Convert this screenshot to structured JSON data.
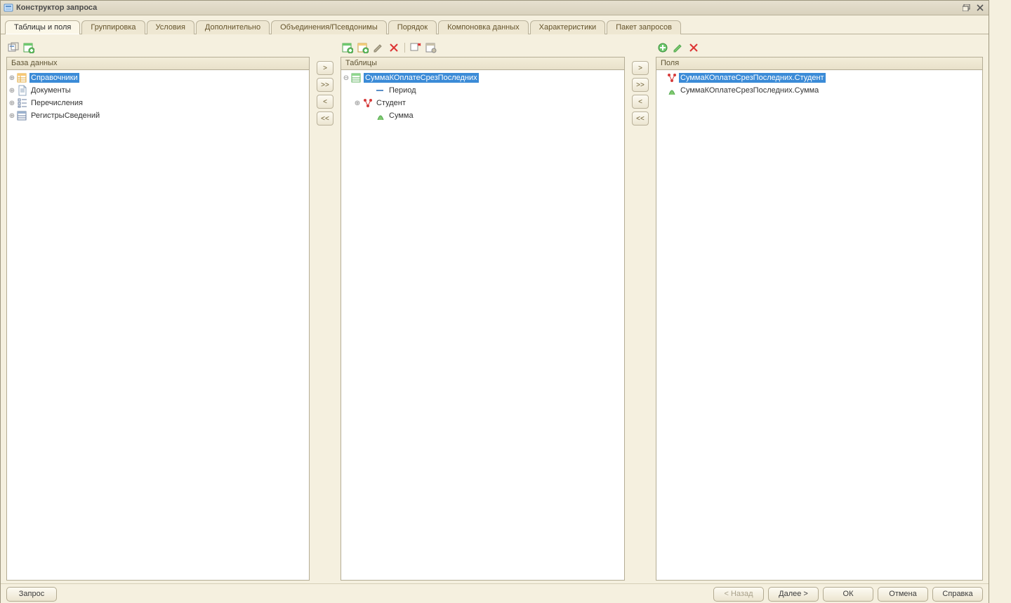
{
  "title": "Конструктор запроса",
  "tabs": [
    "Таблицы и поля",
    "Группировка",
    "Условия",
    "Дополнительно",
    "Объединения/Псевдонимы",
    "Порядок",
    "Компоновка данных",
    "Характеристики",
    "Пакет запросов"
  ],
  "active_tab": 0,
  "database": {
    "header": "База данных",
    "items": [
      "Справочники",
      "Документы",
      "Перечисления",
      "РегистрыСведений"
    ],
    "selected": 0
  },
  "tables": {
    "header": "Таблицы",
    "root": "СуммаКОплатеСрезПоследних",
    "selected": true,
    "children": [
      {
        "label": "Период",
        "expandable": false,
        "icon": "period"
      },
      {
        "label": "Студент",
        "expandable": true,
        "icon": "ref"
      },
      {
        "label": "Сумма",
        "expandable": false,
        "icon": "sum"
      }
    ]
  },
  "fields": {
    "header": "Поля",
    "items": [
      {
        "label": "СуммаКОплатеСрезПоследних.Студент",
        "icon": "ref",
        "selected": true
      },
      {
        "label": "СуммаКОплатеСрезПоследних.Сумма",
        "icon": "sum",
        "selected": false
      }
    ]
  },
  "move": {
    "right": ">",
    "right_all": ">>",
    "left": "<",
    "left_all": "<<"
  },
  "footer": {
    "query": "Запрос",
    "back": "< Назад",
    "next": "Далее >",
    "ok": "ОК",
    "cancel": "Отмена",
    "help": "Справка"
  }
}
